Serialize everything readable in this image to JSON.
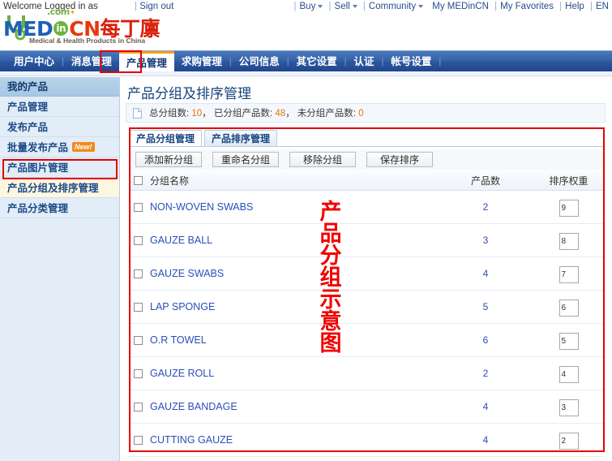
{
  "topbar": {
    "welcome": "Welcome Logged in as",
    "signout": "Sign out",
    "right_items": [
      "Buy",
      "Sell",
      "Community",
      "My MEDinCN",
      "My Favorites",
      "Help",
      "EN"
    ]
  },
  "logo": {
    "med": "MED",
    "in": "in",
    "cn": "CN",
    "cn_chinese": "每丁廪",
    "dotcom": ".com",
    "tagline": "Medical & Health Products in China"
  },
  "nav": {
    "items": [
      {
        "label": "用户中心",
        "active": false
      },
      {
        "label": "消息管理",
        "active": false
      },
      {
        "label": "产品管理",
        "active": true
      },
      {
        "label": "求购管理",
        "active": false
      },
      {
        "label": "公司信息",
        "active": false
      },
      {
        "label": "其它设置",
        "active": false
      },
      {
        "label": "认证",
        "active": false
      },
      {
        "label": "帐号设置",
        "active": false
      }
    ]
  },
  "sidebar": {
    "header": "我的产品",
    "items": [
      {
        "label": "产品管理",
        "selected": false,
        "badge": null
      },
      {
        "label": "发布产品",
        "selected": false,
        "badge": null
      },
      {
        "label": "批量发布产品",
        "selected": false,
        "badge": "New!"
      },
      {
        "label": "产品图片管理",
        "selected": false,
        "badge": null
      },
      {
        "label": "产品分组及排序管理",
        "selected": true,
        "badge": null
      },
      {
        "label": "产品分类管理",
        "selected": false,
        "badge": null
      }
    ]
  },
  "content": {
    "page_title": "产品分组及排序管理",
    "info": {
      "label_total": "总分组数:",
      "value_total": "10",
      "sep1": "，",
      "label_grouped": "已分组产品数:",
      "value_grouped": "48",
      "sep2": "，",
      "label_ungrouped": "未分组产品数:",
      "value_ungrouped": "0"
    },
    "tabs": [
      {
        "label": "产品分组管理",
        "active": true
      },
      {
        "label": "产品排序管理",
        "active": false
      }
    ],
    "buttons": [
      {
        "label": "添加新分组"
      },
      {
        "label": "重命名分组"
      },
      {
        "label": "移除分组"
      },
      {
        "label": "保存排序"
      }
    ],
    "table": {
      "headers": {
        "name": "分组名称",
        "count": "产品数",
        "weight": "排序权重"
      },
      "rows": [
        {
          "name": "NON-WOVEN SWABS",
          "count": "2",
          "weight": "9"
        },
        {
          "name": "GAUZE BALL",
          "count": "3",
          "weight": "8"
        },
        {
          "name": "GAUZE SWABS",
          "count": "4",
          "weight": "7"
        },
        {
          "name": "LAP SPONGE",
          "count": "5",
          "weight": "6"
        },
        {
          "name": "O.R TOWEL",
          "count": "6",
          "weight": "5"
        },
        {
          "name": "GAUZE ROLL",
          "count": "2",
          "weight": "4"
        },
        {
          "name": "GAUZE BANDAGE",
          "count": "4",
          "weight": "3"
        },
        {
          "name": "CUTTING GAUZE",
          "count": "4",
          "weight": "2"
        }
      ]
    }
  },
  "annotations": {
    "vertical_text": "产品分组示意图",
    "color": "#f20000"
  }
}
